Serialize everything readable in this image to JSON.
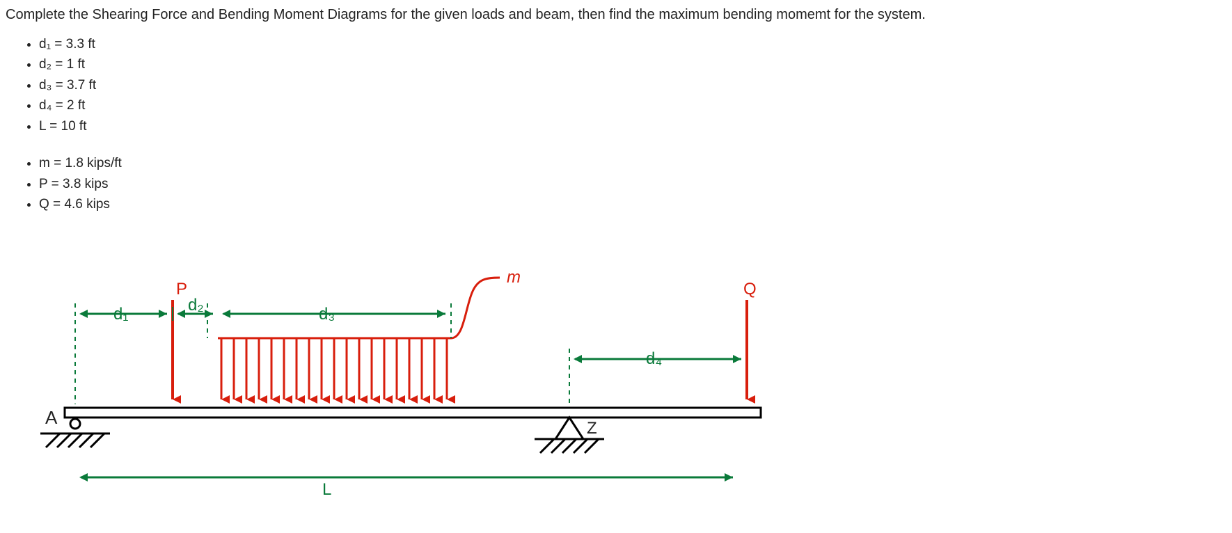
{
  "instruction": "Complete the Shearing Force and Bending Moment Diagrams for the given loads and beam, then find the maximum bending momemt for the system.",
  "given1": [
    "d₁ = 3.3 ft",
    "d₂ = 1 ft",
    "d₃ = 3.7 ft",
    "d₄ = 2 ft",
    "L = 10 ft"
  ],
  "given2": [
    "m = 1.8 kips/ft",
    "P = 3.8 kips",
    "Q = 4.6 kips"
  ],
  "labels": {
    "A": "A",
    "Z": "Z",
    "P": "P",
    "Q": "Q",
    "m": "m",
    "d1": "d₁",
    "d2": "d₂",
    "d3": "d₃",
    "d4": "d₄",
    "L": "L"
  },
  "problem_data": {
    "units": {
      "length": "ft",
      "force": "kips",
      "distributed_load": "kips/ft"
    },
    "d1": 3.3,
    "d2": 1.0,
    "d3": 3.7,
    "d4": 2.0,
    "L": 10.0,
    "m": 1.8,
    "P": 3.8,
    "Q": 4.6,
    "supports": {
      "A": {
        "type": "roller",
        "x_ft": 0
      },
      "Z": {
        "type": "pin",
        "x_ft": 8.0
      }
    },
    "loads": {
      "P_point": {
        "x_ft": 3.3,
        "magnitude_kips": 3.8,
        "direction": "down"
      },
      "distributed_m": {
        "x_start_ft": 4.3,
        "x_end_ft": 8.0,
        "intensity_kips_per_ft": 1.8,
        "direction": "down"
      },
      "Q_point": {
        "x_ft": 10.0,
        "magnitude_kips": 4.6,
        "direction": "down"
      }
    }
  }
}
